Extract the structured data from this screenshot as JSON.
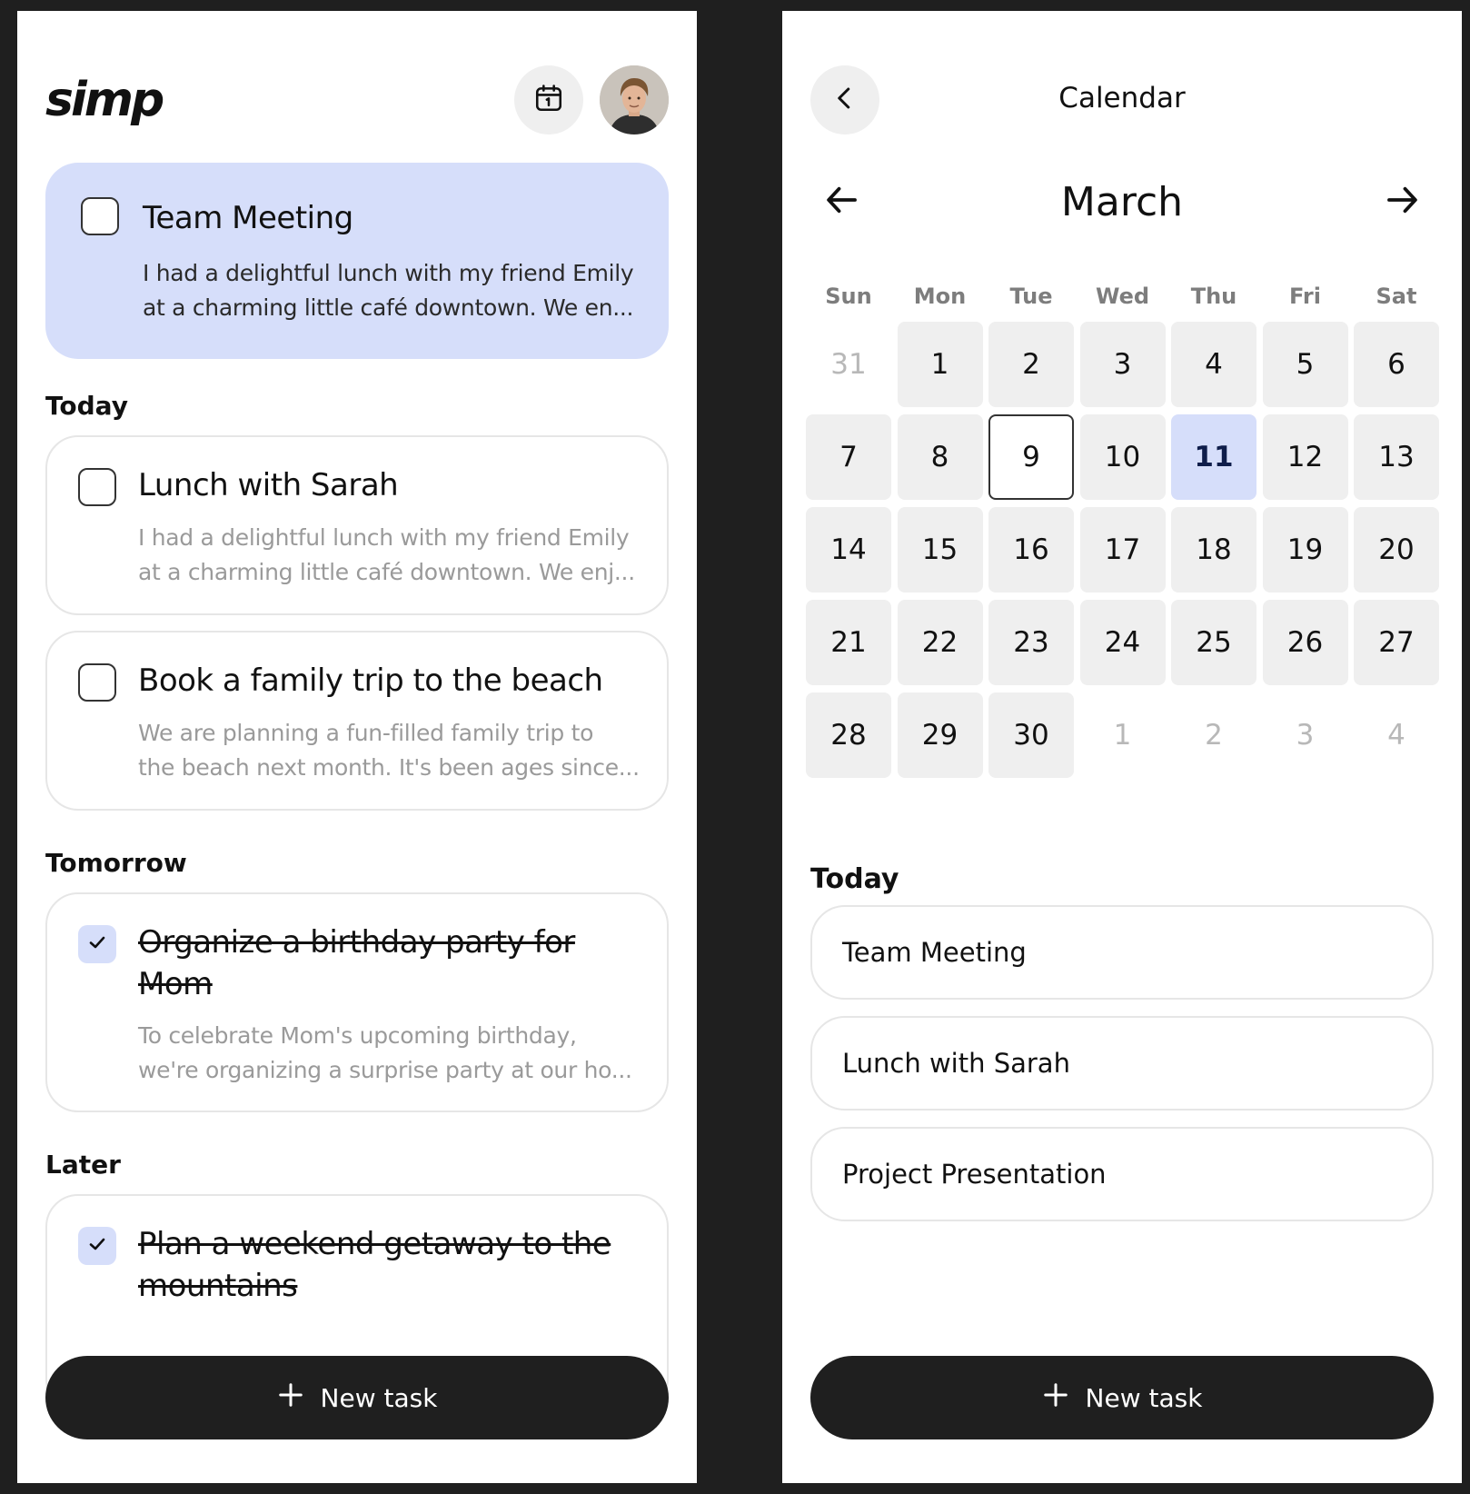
{
  "tasks_screen": {
    "logo": "simp",
    "featured": {
      "title": "Team Meeting",
      "description_line1": "I had a delightful lunch with my friend Emily",
      "description_line2": "at a charming little café downtown. We en...",
      "checked": false
    },
    "sections": {
      "today": {
        "label": "Today",
        "tasks": [
          {
            "title": "Lunch with Sarah",
            "description_line1": "I had a delightful lunch with my friend Emily",
            "description_line2": "at a charming little café downtown. We enj...",
            "checked": false
          },
          {
            "title": "Book a family trip to the beach",
            "description_line1": "We are planning a fun-filled family trip to",
            "description_line2": "the beach next month. It's been ages since...",
            "checked": false
          }
        ]
      },
      "tomorrow": {
        "label": "Tomorrow",
        "tasks": [
          {
            "title_line1": "Organize a birthday party for",
            "title_line2": "Mom",
            "description_line1": "To celebrate Mom's upcoming birthday,",
            "description_line2": "we're organizing a surprise party at our ho...",
            "checked": true
          }
        ]
      },
      "later": {
        "label": "Later",
        "tasks": [
          {
            "title_line1": "Plan a weekend getaway to the",
            "title_line2": "mountains",
            "checked": true
          }
        ]
      }
    },
    "new_task_label": "New task"
  },
  "calendar_screen": {
    "title": "Calendar",
    "month": "March",
    "weekdays": [
      "Sun",
      "Mon",
      "Tue",
      "Wed",
      "Thu",
      "Fri",
      "Sat"
    ],
    "days": [
      {
        "label": "31",
        "state": "outside"
      },
      {
        "label": "1",
        "state": "normal"
      },
      {
        "label": "2",
        "state": "normal"
      },
      {
        "label": "3",
        "state": "normal"
      },
      {
        "label": "4",
        "state": "normal"
      },
      {
        "label": "5",
        "state": "normal"
      },
      {
        "label": "6",
        "state": "normal"
      },
      {
        "label": "7",
        "state": "normal"
      },
      {
        "label": "8",
        "state": "normal"
      },
      {
        "label": "9",
        "state": "selected"
      },
      {
        "label": "10",
        "state": "normal"
      },
      {
        "label": "11",
        "state": "today"
      },
      {
        "label": "12",
        "state": "normal"
      },
      {
        "label": "13",
        "state": "normal"
      },
      {
        "label": "14",
        "state": "normal"
      },
      {
        "label": "15",
        "state": "normal"
      },
      {
        "label": "16",
        "state": "normal"
      },
      {
        "label": "17",
        "state": "normal"
      },
      {
        "label": "18",
        "state": "normal"
      },
      {
        "label": "19",
        "state": "normal"
      },
      {
        "label": "20",
        "state": "normal"
      },
      {
        "label": "21",
        "state": "normal"
      },
      {
        "label": "22",
        "state": "normal"
      },
      {
        "label": "23",
        "state": "normal"
      },
      {
        "label": "24",
        "state": "normal"
      },
      {
        "label": "25",
        "state": "normal"
      },
      {
        "label": "26",
        "state": "normal"
      },
      {
        "label": "27",
        "state": "normal"
      },
      {
        "label": "28",
        "state": "normal"
      },
      {
        "label": "29",
        "state": "normal"
      },
      {
        "label": "30",
        "state": "normal"
      },
      {
        "label": "1",
        "state": "outside"
      },
      {
        "label": "2",
        "state": "outside"
      },
      {
        "label": "3",
        "state": "outside"
      },
      {
        "label": "4",
        "state": "outside"
      }
    ],
    "today_label": "Today",
    "events": [
      "Team Meeting",
      "Lunch with Sarah",
      "Project Presentation"
    ],
    "new_task_label": "New task"
  },
  "colors": {
    "accent_lavender": "#d6defa",
    "dark": "#1f1f1f",
    "muted_text": "#9a9a9a",
    "cell_gray": "#efefef"
  },
  "icons": {
    "calendar_button": "calendar-icon",
    "back_button": "chevron-left-icon",
    "prev_month": "arrow-left-icon",
    "next_month": "arrow-right-icon",
    "new_task": "plus-icon",
    "check": "check-icon"
  }
}
